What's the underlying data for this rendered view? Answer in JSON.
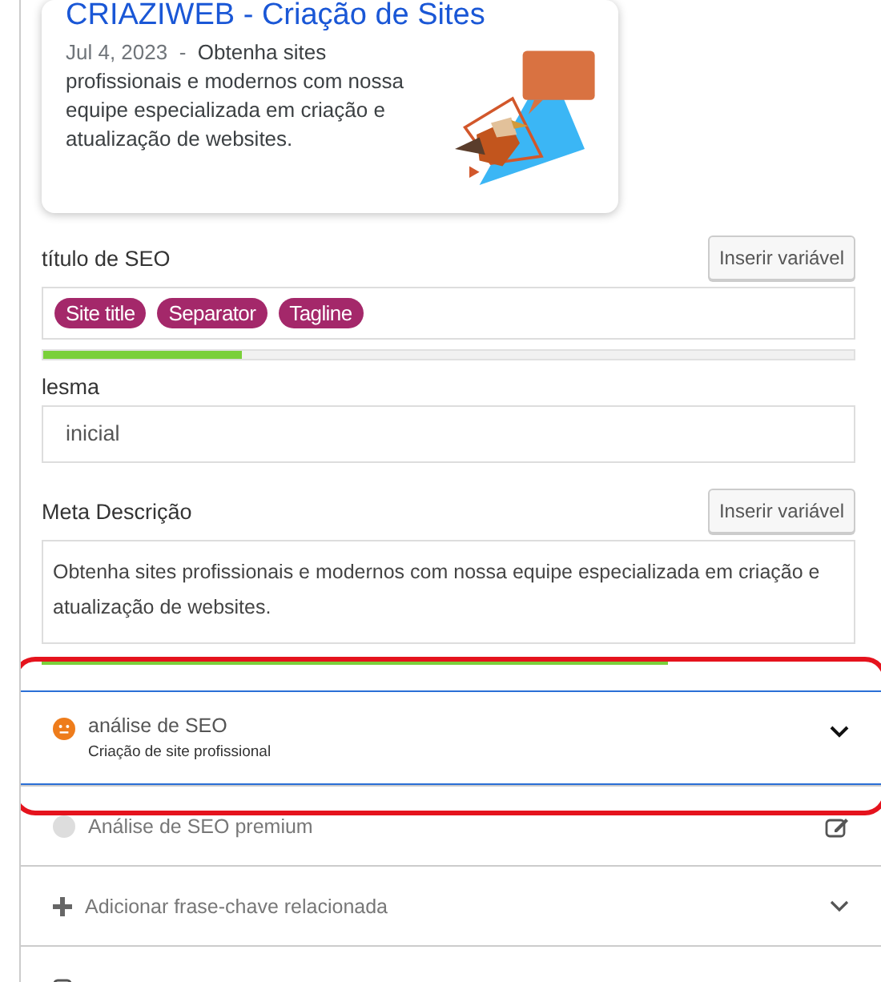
{
  "preview": {
    "title": "CRIAZIWEB - Criação de Sites",
    "date": "Jul 4, 2023",
    "separator": "-",
    "description": "Obtenha sites profissionais e modernos com nossa equipe especializada em criação e atualização de websites."
  },
  "seo_title": {
    "label": "título de SEO",
    "button": "Inserir variável",
    "tags": [
      "Site title",
      "Separator",
      "Tagline"
    ],
    "level": 0.245
  },
  "slug": {
    "label": "lesma",
    "value": "inicial"
  },
  "meta": {
    "label": "Meta Descrição",
    "button": "Inserir variável",
    "value": "Obtenha sites profissionais e modernos com nossa equipe especializada em criação e atualização de websites.",
    "level": 0.77
  },
  "sections": [
    {
      "kind": "score",
      "title": "análise de SEO",
      "subtitle": "Criação de site profissional",
      "color": "#ee7c1b",
      "expanded": false,
      "highlighted": true
    },
    {
      "kind": "premium",
      "title": "Análise de SEO premium",
      "color": "#dddddd"
    },
    {
      "kind": "add",
      "title": "Adicionar frase-chave relacionada",
      "expanded": false
    },
    {
      "kind": "cut"
    }
  ]
}
